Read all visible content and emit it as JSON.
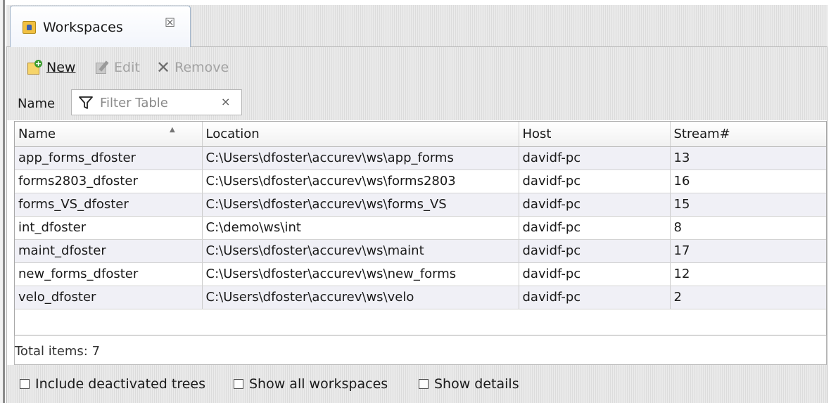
{
  "tab": {
    "label": "Workspaces",
    "close_glyph": "☒"
  },
  "toolbar": {
    "new_label": "New",
    "edit_label": "Edit",
    "remove_label": "Remove"
  },
  "filter": {
    "label": "Name",
    "placeholder": "Filter Table",
    "value": "",
    "clear_glyph": "×"
  },
  "table": {
    "columns": [
      "Name",
      "Location",
      "Host",
      "Stream#"
    ],
    "sort": {
      "column": "Name",
      "direction": "ascending"
    },
    "rows": [
      {
        "name": "app_forms_dfoster",
        "location": "C:\\Users\\dfoster\\accurev\\ws\\app_forms",
        "host": "davidf-pc",
        "stream": "13"
      },
      {
        "name": "forms2803_dfoster",
        "location": "C:\\Users\\dfoster\\accurev\\ws\\forms2803",
        "host": "davidf-pc",
        "stream": "16"
      },
      {
        "name": "forms_VS_dfoster",
        "location": "C:\\Users\\dfoster\\accurev\\ws\\forms_VS",
        "host": "davidf-pc",
        "stream": "15"
      },
      {
        "name": "int_dfoster",
        "location": "C:\\demo\\ws\\int",
        "host": "davidf-pc",
        "stream": "8"
      },
      {
        "name": "maint_dfoster",
        "location": "C:\\Users\\dfoster\\accurev\\ws\\maint",
        "host": "davidf-pc",
        "stream": "17"
      },
      {
        "name": "new_forms_dfoster",
        "location": "C:\\Users\\dfoster\\accurev\\ws\\new_forms",
        "host": "davidf-pc",
        "stream": "12"
      },
      {
        "name": "velo_dfoster",
        "location": "C:\\Users\\dfoster\\accurev\\ws\\velo",
        "host": "davidf-pc",
        "stream": "2"
      }
    ]
  },
  "status": {
    "total_text": "Total items: 7"
  },
  "options": [
    {
      "label": "Include deactivated trees",
      "checked": false
    },
    {
      "label": "Show all workspaces",
      "checked": false
    },
    {
      "label": "Show details",
      "checked": false
    }
  ]
}
